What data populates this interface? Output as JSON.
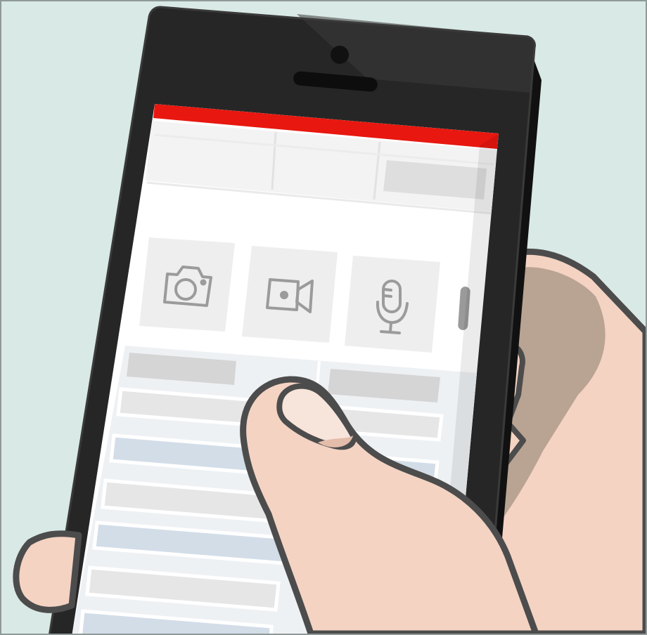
{
  "illustration": {
    "subject": "hand-holding-smartphone",
    "colors": {
      "background": "#d9e9e5",
      "phone_body": "#242424",
      "phone_side": "#111111",
      "screen": "#ffffff",
      "accent_bar": "#e8170f",
      "skin": "#f4d3c3",
      "skin_shadow": "#b9a392",
      "outline": "#4c4c4c",
      "placeholder_gray": "#dedede",
      "placeholder_blue": "#d3dde8",
      "icon_tile": "#eeeeee",
      "icon_stroke": "#9b9b9b"
    }
  },
  "screen": {
    "header_bar": {
      "accent": "#e8170f"
    },
    "media_buttons": [
      {
        "icon": "camera-icon"
      },
      {
        "icon": "video-camera-icon"
      },
      {
        "icon": "microphone-icon"
      }
    ]
  }
}
